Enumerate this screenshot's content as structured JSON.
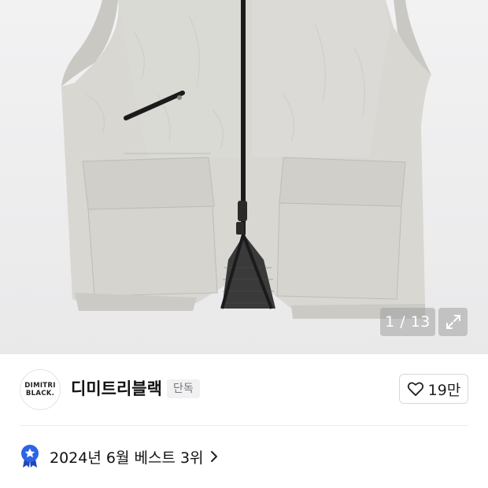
{
  "gallery": {
    "counter_text": "1 / 13",
    "image_icon": "vest-product-photo",
    "expand_icon": "expand-arrows-icon"
  },
  "brand": {
    "logo_line1": "DIMITRI",
    "logo_line2": "BLACK.",
    "name": "디미트리블랙",
    "tag": "단독"
  },
  "like": {
    "icon": "heart-outline-icon",
    "count": "19만"
  },
  "ranking": {
    "icon": "medal-star-icon",
    "text": "2024년 6월 베스트 3위",
    "chevron": "chevron-right-icon"
  },
  "colors": {
    "garment": "#d6d5d0",
    "zipper": "#1b1b1b",
    "badge_blue": "#2b64e8"
  }
}
